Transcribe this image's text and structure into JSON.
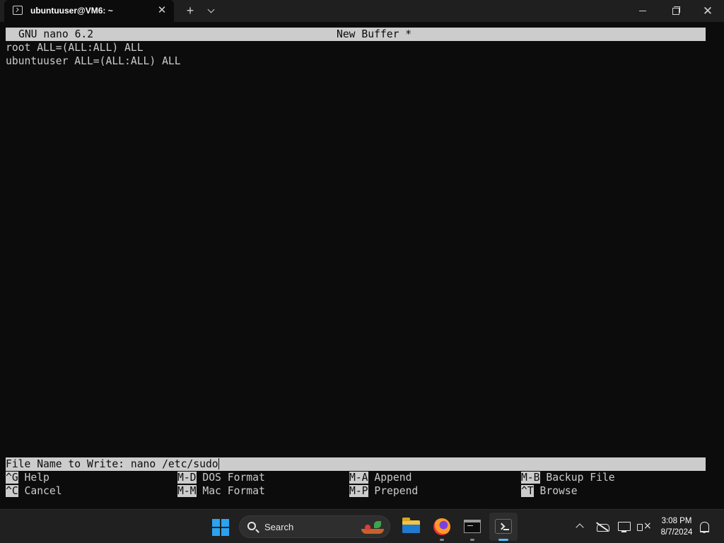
{
  "window": {
    "tab_title": "ubuntuuser@VM6: ~",
    "tab_close_glyph": "✕",
    "new_tab_glyph": "+",
    "close_glyph": "✕"
  },
  "nano": {
    "version": "GNU nano 6.2",
    "filename": "New Buffer *",
    "lines": [
      "root ALL=(ALL:ALL) ALL",
      "ubuntuuser ALL=(ALL:ALL) ALL"
    ],
    "prompt": "File Name to Write: nano /etc/sudo",
    "shortcuts": [
      [
        {
          "key": "^G",
          "label": " Help"
        },
        {
          "key": "M-D",
          "label": " DOS Format"
        },
        {
          "key": "M-A",
          "label": " Append"
        },
        {
          "key": "M-B",
          "label": " Backup File"
        }
      ],
      [
        {
          "key": "^C",
          "label": " Cancel"
        },
        {
          "key": "M-M",
          "label": " Mac Format"
        },
        {
          "key": "M-P",
          "label": " Prepend"
        },
        {
          "key": "^T",
          "label": " Browse"
        }
      ]
    ]
  },
  "taskbar": {
    "search_label": "Search",
    "apps": [
      "file-explorer",
      "firefox",
      "command-prompt",
      "windows-terminal"
    ],
    "active_app": "windows-terminal",
    "time": "3:08 PM",
    "date": "8/7/2024"
  },
  "colors": {
    "terminal_bg": "#0c0c0c",
    "terminal_fg": "#cccccc",
    "titlebar_bg": "#1f1f1f",
    "taskbar_bg": "#202020",
    "accent": "#4cc2ff"
  }
}
